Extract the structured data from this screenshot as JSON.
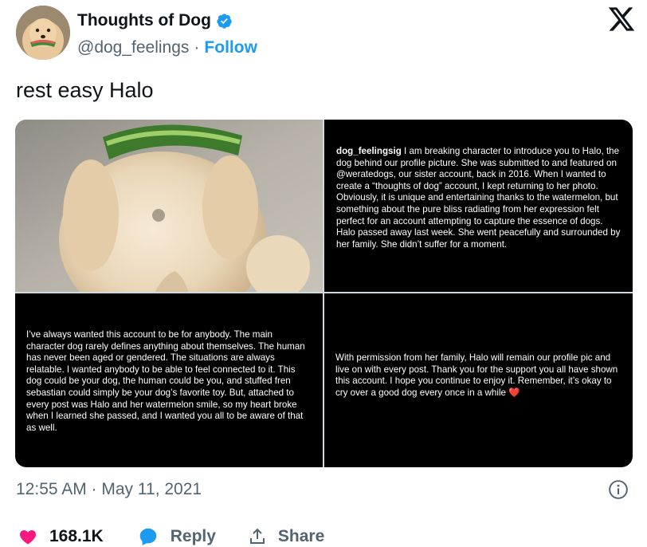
{
  "author": {
    "display_name": "Thoughts of Dog",
    "handle": "@dog_feelings",
    "separator": "·",
    "follow_label": "Follow"
  },
  "tweet": {
    "text": "rest easy Halo",
    "timestamp": "12:55 AM · May 11, 2021"
  },
  "media": {
    "panel_1_alt": "golden retriever holding watermelon slice",
    "panel_2": {
      "username": "dog_feelingsig",
      "text": "I am breaking character to introduce you to Halo, the dog behind our profile picture. She was submitted to and featured on @weratedogs, our sister account, back in 2016. When I wanted to create a “thoughts of dog” account, I kept returning to her photo. Obviously, it is unique and entertaining thanks to the watermelon, but something about the pure bliss radiating from her expression felt perfect for an account attempting to capture the essence of dogs. Halo passed away last week. She went peacefully and surrounded by her family. She didn’t suffer for a moment."
    },
    "panel_3": {
      "text": "I’ve always wanted this account to be for anybody. The main character dog rarely defines anything about themselves. The human has never been aged or gendered. The situations are always relatable. I wanted anybody to be able to feel connected to it. This dog could be your dog, the human could be you, and stuffed fren sebastian could simply be your dog’s favorite toy. But, attached to every post was Halo and her watermelon smile, so my heart broke when I learned she passed, and I wanted you all to be aware of that as well."
    },
    "panel_4": {
      "text": "With permission from her family, Halo will remain our profile pic and live on with every post. Thank you for the support you all have shown this account. I hope you continue to enjoy it. Remember, it’s okay to cry over a good dog every once in a while",
      "emoji": "❤️"
    }
  },
  "actions": {
    "like_count": "168.1K",
    "reply_label": "Reply",
    "share_label": "Share"
  },
  "colors": {
    "accent": "#1d9bf0",
    "heart": "#f91880",
    "muted": "#536471"
  },
  "icons": [
    "verified-badge-icon",
    "x-logo-icon",
    "info-icon",
    "heart-icon",
    "reply-icon",
    "share-icon"
  ]
}
